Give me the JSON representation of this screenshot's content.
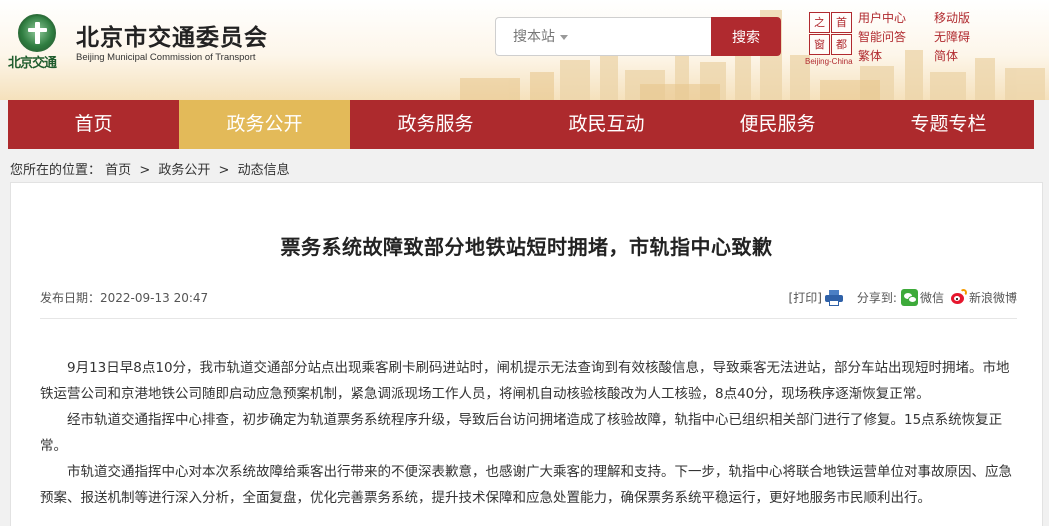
{
  "header": {
    "logo_text": "北京交通",
    "site_name": "北京市交通委员会",
    "site_subtitle": "Beijing Municipal Commission of Transport",
    "search": {
      "placeholder": "搜本站",
      "button_label": "搜索"
    },
    "capital_logo": {
      "chars": [
        "之",
        "首",
        "窗",
        "都"
      ],
      "caption": "Beijing-China"
    },
    "quick_links": [
      "用户中心",
      "移动版",
      "智能问答",
      "无障碍",
      "繁体",
      "简体"
    ]
  },
  "nav": {
    "items": [
      "首页",
      "政务公开",
      "政务服务",
      "政民互动",
      "便民服务",
      "专题专栏"
    ],
    "active_index": 1
  },
  "breadcrumb": {
    "prefix": "您所在的位置：",
    "items": [
      "首页",
      "政务公开",
      "动态信息"
    ]
  },
  "article": {
    "title": "票务系统故障致部分地铁站短时拥堵，市轨指中心致歉",
    "publish_label": "发布日期：",
    "publish_date": "2022-09-13 20:47",
    "print_label": "[打印]",
    "share_label": "分享到:",
    "share_targets": [
      "微信",
      "新浪微博"
    ],
    "paragraphs": [
      "9月13日早8点10分，我市轨道交通部分站点出现乘客刷卡刷码进站时，闸机提示无法查询到有效核酸信息，导致乘客无法进站，部分车站出现短时拥堵。市地铁运营公司和京港地铁公司随即启动应急预案机制，紧急调派现场工作人员，将闸机自动核验核酸改为人工核验，8点40分，现场秩序逐渐恢复正常。",
      "经市轨道交通指挥中心排查，初步确定为轨道票务系统程序升级，导致后台访问拥堵造成了核验故障，轨指中心已组织相关部门进行了修复。15点系统恢复正常。",
      "市轨道交通指挥中心对本次系统故障给乘客出行带来的不便深表歉意，也感谢广大乘客的理解和支持。下一步，轨指中心将联合地铁运营单位对事故原因、应急预案、报送机制等进行深入分析，全面复盘，优化完善票务系统，提升技术保障和应急处置能力，确保票务系统平稳运行，更好地服务市民顺利出行。"
    ]
  },
  "colors": {
    "brand_red": "#ad2a2d",
    "nav_active": "#e3ba59",
    "search_button": "#b02a2f",
    "link_red": "#b02a2f",
    "logo_green": "#2f7d40"
  }
}
